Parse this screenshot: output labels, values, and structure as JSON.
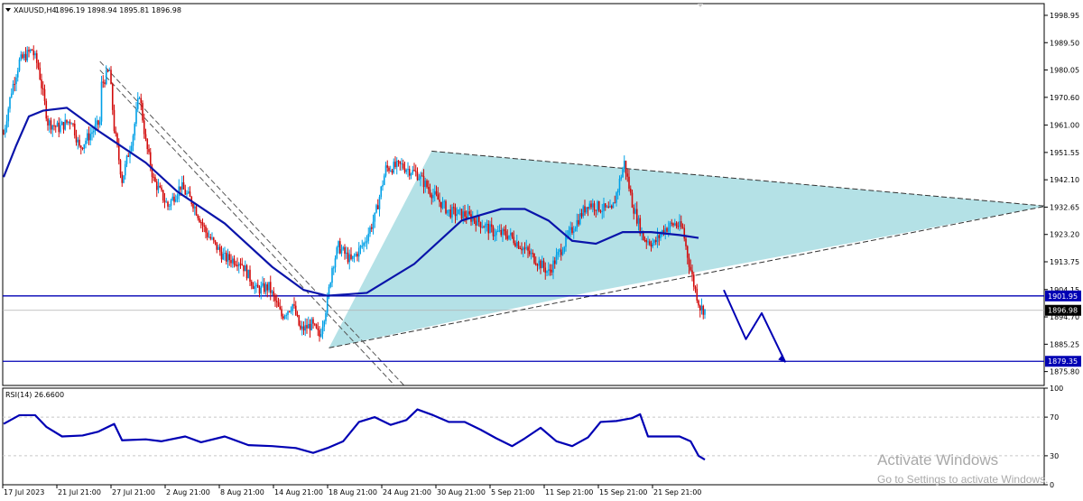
{
  "window": {
    "symbol_header": "XAUUSD,H4",
    "ohlc_text": "1896.19 1898.94 1895.81 1896.98"
  },
  "price_axis": {
    "ticks": [
      "1998.95",
      "1989.50",
      "1980.05",
      "1970.60",
      "1961.00",
      "1951.55",
      "1942.10",
      "1932.65",
      "1923.20",
      "1913.75",
      "1904.15",
      "1894.70",
      "1885.25",
      "1875.80"
    ],
    "tick_values": [
      1998.95,
      1989.5,
      1980.05,
      1970.6,
      1961.0,
      1951.55,
      1942.1,
      1932.65,
      1923.2,
      1913.75,
      1904.15,
      1894.7,
      1885.25,
      1875.8
    ]
  },
  "levels": [
    {
      "name": "upper-support-line",
      "label": "1901.95",
      "value": 1901.95,
      "color": "#0000b4"
    },
    {
      "name": "current-price",
      "label": "1896.98",
      "value": 1896.98,
      "color": "#000000"
    },
    {
      "name": "target-line",
      "label": "1879.35",
      "value": 1879.35,
      "color": "#0000b4"
    }
  ],
  "time_axis": {
    "labels": [
      "17 Jul 2023",
      "21 Jul 21:00",
      "27 Jul 21:00",
      "2 Aug 21:00",
      "8 Aug 21:00",
      "14 Aug 21:00",
      "18 Aug 21:00",
      "24 Aug 21:00",
      "30 Aug 21:00",
      "5 Sep 21:00",
      "11 Sep 21:00",
      "15 Sep 21:00",
      "21 Sep 21:00"
    ]
  },
  "rsi": {
    "label": "RSI(14) 26.6600",
    "ticks": [
      "100",
      "70",
      "30",
      "0"
    ],
    "tick_values": [
      100,
      70,
      30,
      0
    ],
    "color": "#0000b4"
  },
  "colors": {
    "bull": "#00a0e6",
    "bear": "#d20a0a",
    "ma": "#0a14aa",
    "triangle_fill": "#b4e1e6",
    "projection": "#0000b4",
    "grid": "#c8c8c8"
  },
  "watermark": {
    "title": "Activate Windows",
    "subtitle": "Go to Settings to activate Windows."
  },
  "chart_data": {
    "type": "candlestick",
    "symbol": "XAUUSD",
    "timeframe": "H4",
    "last": {
      "open": 1896.19,
      "high": 1898.94,
      "low": 1895.81,
      "close": 1896.98
    },
    "price_range": [
      1871,
      2003
    ],
    "moving_average": [
      [
        0,
        1943
      ],
      [
        8,
        1954
      ],
      [
        16,
        1964
      ],
      [
        25,
        1966
      ],
      [
        40,
        1967
      ],
      [
        60,
        1959
      ],
      [
        90,
        1948
      ],
      [
        110,
        1938
      ],
      [
        140,
        1927
      ],
      [
        170,
        1912
      ],
      [
        190,
        1904
      ],
      [
        205,
        1902
      ],
      [
        230,
        1903
      ],
      [
        260,
        1913
      ],
      [
        290,
        1928
      ],
      [
        315,
        1932
      ],
      [
        330,
        1932
      ],
      [
        345,
        1928
      ],
      [
        360,
        1921
      ],
      [
        375,
        1920
      ],
      [
        392,
        1924
      ],
      [
        410,
        1924
      ],
      [
        428,
        1923
      ],
      [
        440,
        1922
      ]
    ],
    "rsi_series": [
      [
        0,
        63
      ],
      [
        10,
        72
      ],
      [
        20,
        72
      ],
      [
        27,
        60
      ],
      [
        37,
        50
      ],
      [
        50,
        51
      ],
      [
        60,
        55
      ],
      [
        70,
        63
      ],
      [
        75,
        46
      ],
      [
        90,
        47
      ],
      [
        100,
        45
      ],
      [
        115,
        50
      ],
      [
        125,
        44
      ],
      [
        140,
        50
      ],
      [
        155,
        41
      ],
      [
        170,
        40
      ],
      [
        185,
        38
      ],
      [
        196,
        33
      ],
      [
        205,
        38
      ],
      [
        215,
        45
      ],
      [
        225,
        65
      ],
      [
        235,
        70
      ],
      [
        245,
        62
      ],
      [
        255,
        67
      ],
      [
        262,
        78
      ],
      [
        272,
        72
      ],
      [
        282,
        65
      ],
      [
        292,
        65
      ],
      [
        302,
        57
      ],
      [
        312,
        48
      ],
      [
        322,
        40
      ],
      [
        330,
        48
      ],
      [
        340,
        59
      ],
      [
        350,
        45
      ],
      [
        360,
        40
      ],
      [
        370,
        49
      ],
      [
        378,
        65
      ],
      [
        388,
        66
      ],
      [
        398,
        69
      ],
      [
        403,
        73
      ],
      [
        408,
        50
      ],
      [
        418,
        50
      ],
      [
        428,
        50
      ],
      [
        435,
        45
      ],
      [
        440,
        30
      ],
      [
        444,
        26
      ]
    ],
    "candle_path": [
      [
        0,
        1958
      ],
      [
        5,
        1973
      ],
      [
        10,
        1983
      ],
      [
        18,
        1987
      ],
      [
        22,
        1981
      ],
      [
        28,
        1962
      ],
      [
        35,
        1960
      ],
      [
        43,
        1963
      ],
      [
        48,
        1953
      ],
      [
        55,
        1958
      ],
      [
        61,
        1962
      ],
      [
        62,
        1975
      ],
      [
        67,
        1980
      ],
      [
        70,
        1960
      ],
      [
        75,
        1942
      ],
      [
        82,
        1958
      ],
      [
        86,
        1972
      ],
      [
        90,
        1955
      ],
      [
        95,
        1942
      ],
      [
        104,
        1933
      ],
      [
        112,
        1940
      ],
      [
        120,
        1934
      ],
      [
        128,
        1924
      ],
      [
        140,
        1915
      ],
      [
        150,
        1914
      ],
      [
        160,
        1904
      ],
      [
        168,
        1905
      ],
      [
        176,
        1895
      ],
      [
        183,
        1899
      ],
      [
        188,
        1890
      ],
      [
        195,
        1892
      ],
      [
        200,
        1888
      ],
      [
        205,
        1900
      ],
      [
        208,
        1912
      ],
      [
        212,
        1919
      ],
      [
        220,
        1914
      ],
      [
        228,
        1920
      ],
      [
        235,
        1929
      ],
      [
        242,
        1946
      ],
      [
        252,
        1947
      ],
      [
        262,
        1944
      ],
      [
        272,
        1937
      ],
      [
        282,
        1931
      ],
      [
        292,
        1930
      ],
      [
        300,
        1928
      ],
      [
        310,
        1924
      ],
      [
        320,
        1923
      ],
      [
        330,
        1918
      ],
      [
        340,
        1913
      ],
      [
        345,
        1910
      ],
      [
        350,
        1915
      ],
      [
        360,
        1925
      ],
      [
        370,
        1934
      ],
      [
        385,
        1931
      ],
      [
        393,
        1948
      ],
      [
        398,
        1934
      ],
      [
        405,
        1922
      ],
      [
        412,
        1920
      ],
      [
        418,
        1925
      ],
      [
        425,
        1927
      ],
      [
        430,
        1925
      ],
      [
        433,
        1916
      ],
      [
        437,
        1906
      ],
      [
        441,
        1898
      ],
      [
        444,
        1897
      ]
    ],
    "triangle_points": [
      [
        206,
        1884
      ],
      [
        271,
        1952
      ],
      [
        660,
        1933
      ],
      [
        369,
        1903
      ]
    ],
    "projection_path": [
      [
        456,
        1904
      ],
      [
        470,
        1887
      ],
      [
        480,
        1896
      ],
      [
        495,
        1879
      ]
    ]
  }
}
